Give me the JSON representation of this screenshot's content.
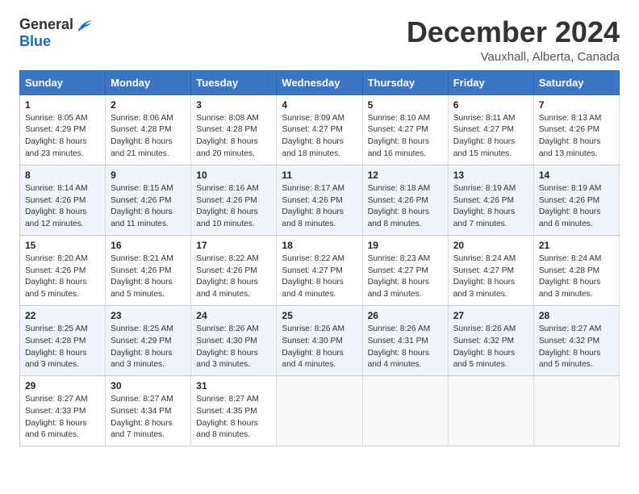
{
  "header": {
    "logo_general": "General",
    "logo_blue": "Blue",
    "month": "December 2024",
    "location": "Vauxhall, Alberta, Canada"
  },
  "weekdays": [
    "Sunday",
    "Monday",
    "Tuesday",
    "Wednesday",
    "Thursday",
    "Friday",
    "Saturday"
  ],
  "weeks": [
    [
      {
        "day": "1",
        "sunrise": "8:05 AM",
        "sunset": "4:29 PM",
        "daylight": "8 hours and 23 minutes."
      },
      {
        "day": "2",
        "sunrise": "8:06 AM",
        "sunset": "4:28 PM",
        "daylight": "8 hours and 21 minutes."
      },
      {
        "day": "3",
        "sunrise": "8:08 AM",
        "sunset": "4:28 PM",
        "daylight": "8 hours and 20 minutes."
      },
      {
        "day": "4",
        "sunrise": "8:09 AM",
        "sunset": "4:27 PM",
        "daylight": "8 hours and 18 minutes."
      },
      {
        "day": "5",
        "sunrise": "8:10 AM",
        "sunset": "4:27 PM",
        "daylight": "8 hours and 16 minutes."
      },
      {
        "day": "6",
        "sunrise": "8:11 AM",
        "sunset": "4:27 PM",
        "daylight": "8 hours and 15 minutes."
      },
      {
        "day": "7",
        "sunrise": "8:13 AM",
        "sunset": "4:26 PM",
        "daylight": "8 hours and 13 minutes."
      }
    ],
    [
      {
        "day": "8",
        "sunrise": "8:14 AM",
        "sunset": "4:26 PM",
        "daylight": "8 hours and 12 minutes."
      },
      {
        "day": "9",
        "sunrise": "8:15 AM",
        "sunset": "4:26 PM",
        "daylight": "8 hours and 11 minutes."
      },
      {
        "day": "10",
        "sunrise": "8:16 AM",
        "sunset": "4:26 PM",
        "daylight": "8 hours and 10 minutes."
      },
      {
        "day": "11",
        "sunrise": "8:17 AM",
        "sunset": "4:26 PM",
        "daylight": "8 hours and 8 minutes."
      },
      {
        "day": "12",
        "sunrise": "8:18 AM",
        "sunset": "4:26 PM",
        "daylight": "8 hours and 8 minutes."
      },
      {
        "day": "13",
        "sunrise": "8:19 AM",
        "sunset": "4:26 PM",
        "daylight": "8 hours and 7 minutes."
      },
      {
        "day": "14",
        "sunrise": "8:19 AM",
        "sunset": "4:26 PM",
        "daylight": "8 hours and 6 minutes."
      }
    ],
    [
      {
        "day": "15",
        "sunrise": "8:20 AM",
        "sunset": "4:26 PM",
        "daylight": "8 hours and 5 minutes."
      },
      {
        "day": "16",
        "sunrise": "8:21 AM",
        "sunset": "4:26 PM",
        "daylight": "8 hours and 5 minutes."
      },
      {
        "day": "17",
        "sunrise": "8:22 AM",
        "sunset": "4:26 PM",
        "daylight": "8 hours and 4 minutes."
      },
      {
        "day": "18",
        "sunrise": "8:22 AM",
        "sunset": "4:27 PM",
        "daylight": "8 hours and 4 minutes."
      },
      {
        "day": "19",
        "sunrise": "8:23 AM",
        "sunset": "4:27 PM",
        "daylight": "8 hours and 3 minutes."
      },
      {
        "day": "20",
        "sunrise": "8:24 AM",
        "sunset": "4:27 PM",
        "daylight": "8 hours and 3 minutes."
      },
      {
        "day": "21",
        "sunrise": "8:24 AM",
        "sunset": "4:28 PM",
        "daylight": "8 hours and 3 minutes."
      }
    ],
    [
      {
        "day": "22",
        "sunrise": "8:25 AM",
        "sunset": "4:28 PM",
        "daylight": "8 hours and 3 minutes."
      },
      {
        "day": "23",
        "sunrise": "8:25 AM",
        "sunset": "4:29 PM",
        "daylight": "8 hours and 3 minutes."
      },
      {
        "day": "24",
        "sunrise": "8:26 AM",
        "sunset": "4:30 PM",
        "daylight": "8 hours and 3 minutes."
      },
      {
        "day": "25",
        "sunrise": "8:26 AM",
        "sunset": "4:30 PM",
        "daylight": "8 hours and 4 minutes."
      },
      {
        "day": "26",
        "sunrise": "8:26 AM",
        "sunset": "4:31 PM",
        "daylight": "8 hours and 4 minutes."
      },
      {
        "day": "27",
        "sunrise": "8:26 AM",
        "sunset": "4:32 PM",
        "daylight": "8 hours and 5 minutes."
      },
      {
        "day": "28",
        "sunrise": "8:27 AM",
        "sunset": "4:32 PM",
        "daylight": "8 hours and 5 minutes."
      }
    ],
    [
      {
        "day": "29",
        "sunrise": "8:27 AM",
        "sunset": "4:33 PM",
        "daylight": "8 hours and 6 minutes."
      },
      {
        "day": "30",
        "sunrise": "8:27 AM",
        "sunset": "4:34 PM",
        "daylight": "8 hours and 7 minutes."
      },
      {
        "day": "31",
        "sunrise": "8:27 AM",
        "sunset": "4:35 PM",
        "daylight": "8 hours and 8 minutes."
      },
      null,
      null,
      null,
      null
    ]
  ]
}
